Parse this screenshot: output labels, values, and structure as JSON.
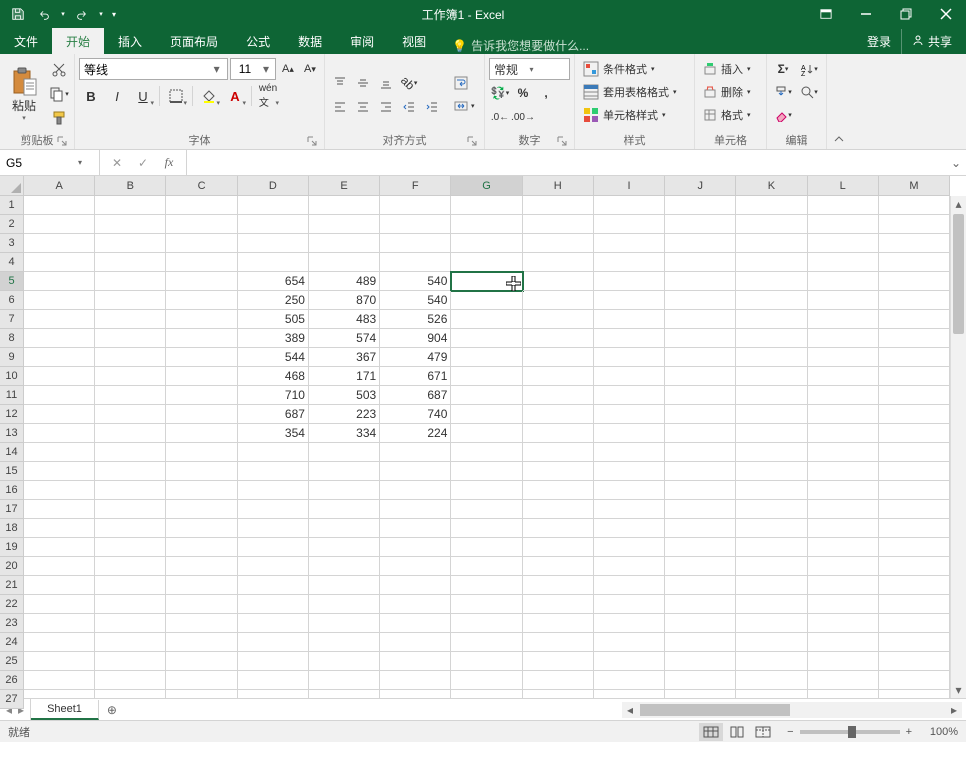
{
  "title": "工作簿1 - Excel",
  "tabs": {
    "file": "文件",
    "home": "开始",
    "insert": "插入",
    "layout": "页面布局",
    "formulas": "公式",
    "data": "数据",
    "review": "审阅",
    "view": "视图",
    "tell_me": "告诉我您想要做什么...",
    "login": "登录",
    "share": "共享"
  },
  "ribbon": {
    "clipboard": {
      "label": "剪贴板",
      "paste": "粘贴"
    },
    "font": {
      "label": "字体",
      "name": "等线",
      "size": "11"
    },
    "alignment": {
      "label": "对齐方式"
    },
    "number": {
      "label": "数字",
      "format": "常规"
    },
    "styles": {
      "label": "样式",
      "cond": "条件格式",
      "table": "套用表格格式",
      "cell": "单元格样式"
    },
    "cells": {
      "label": "单元格",
      "insert": "插入",
      "delete": "删除",
      "format": "格式"
    },
    "editing": {
      "label": "编辑"
    }
  },
  "name_box": "G5",
  "formula": "",
  "columns": [
    "A",
    "B",
    "C",
    "D",
    "E",
    "F",
    "G",
    "H",
    "I",
    "J",
    "K",
    "L",
    "M"
  ],
  "row_count": 27,
  "selected": {
    "row": 5,
    "col": "G",
    "col_index": 6
  },
  "grid_data": {
    "5": {
      "D": "654",
      "E": "489",
      "F": "540"
    },
    "6": {
      "D": "250",
      "E": "870",
      "F": "540"
    },
    "7": {
      "D": "505",
      "E": "483",
      "F": "526"
    },
    "8": {
      "D": "389",
      "E": "574",
      "F": "904"
    },
    "9": {
      "D": "544",
      "E": "367",
      "F": "479"
    },
    "10": {
      "D": "468",
      "E": "171",
      "F": "671"
    },
    "11": {
      "D": "710",
      "E": "503",
      "F": "687"
    },
    "12": {
      "D": "687",
      "E": "223",
      "F": "740"
    },
    "13": {
      "D": "354",
      "E": "334",
      "F": "224"
    }
  },
  "sheet_tab": "Sheet1",
  "status": "就绪",
  "zoom": "100%"
}
